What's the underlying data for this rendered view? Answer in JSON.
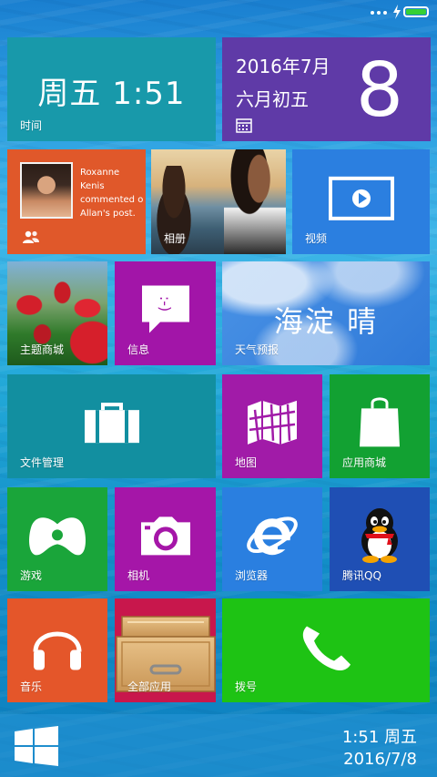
{
  "status_bar": {
    "battery_color": "#35d035"
  },
  "tiles": {
    "clock": {
      "time_text": "周五  1:51",
      "label": "时间",
      "color": "#1899aa"
    },
    "calendar": {
      "line1": "2016年7月",
      "line2": "六月初五",
      "day": "8",
      "icon": "calendar-icon",
      "color": "#5f3aa7"
    },
    "people": {
      "notification": "Roxanne Kenis commented o Allan's post.",
      "name": "Roxanne Kenis",
      "action": "commented o",
      "object": "Allan's post.",
      "icon": "people-icon",
      "color": "#e0582a"
    },
    "photos": {
      "label": "相册"
    },
    "video": {
      "label": "视频",
      "icon": "video-icon",
      "color": "#2b7fe0"
    },
    "theme": {
      "label": "主题商城"
    },
    "message": {
      "label": "信息",
      "icon": "message-icon",
      "color": "#a215a8"
    },
    "weather": {
      "location_condition": "海淀  晴",
      "label": "天气预报"
    },
    "files": {
      "label": "文件管理",
      "icon": "briefcase-icon",
      "color": "#128fa0"
    },
    "map": {
      "label": "地图",
      "icon": "map-icon",
      "color": "#a11ba8"
    },
    "store": {
      "label": "应用商城",
      "icon": "shopping-bag-icon",
      "color": "#12a132"
    },
    "games": {
      "label": "游戏",
      "icon": "gamepad-icon",
      "color": "#1aa53a"
    },
    "camera": {
      "label": "相机",
      "icon": "camera-icon",
      "color": "#a516a8"
    },
    "browser": {
      "label": "浏览器",
      "icon": "ie-icon",
      "color": "#2a7fe0"
    },
    "qq": {
      "label": "腾讯QQ",
      "icon": "qq-penguin-icon",
      "color": "#1f4fb4"
    },
    "music": {
      "label": "音乐",
      "icon": "headphones-icon",
      "color": "#e4562a"
    },
    "allapps": {
      "label": "全部应用",
      "icon": "drawer-icon",
      "color": "#c8174c"
    },
    "dial": {
      "label": "拨号",
      "icon": "phone-icon",
      "color": "#1ec314"
    }
  },
  "taskbar": {
    "time": "1:51 周五",
    "date": "2016/7/8",
    "start_icon": "windows-logo-icon"
  }
}
